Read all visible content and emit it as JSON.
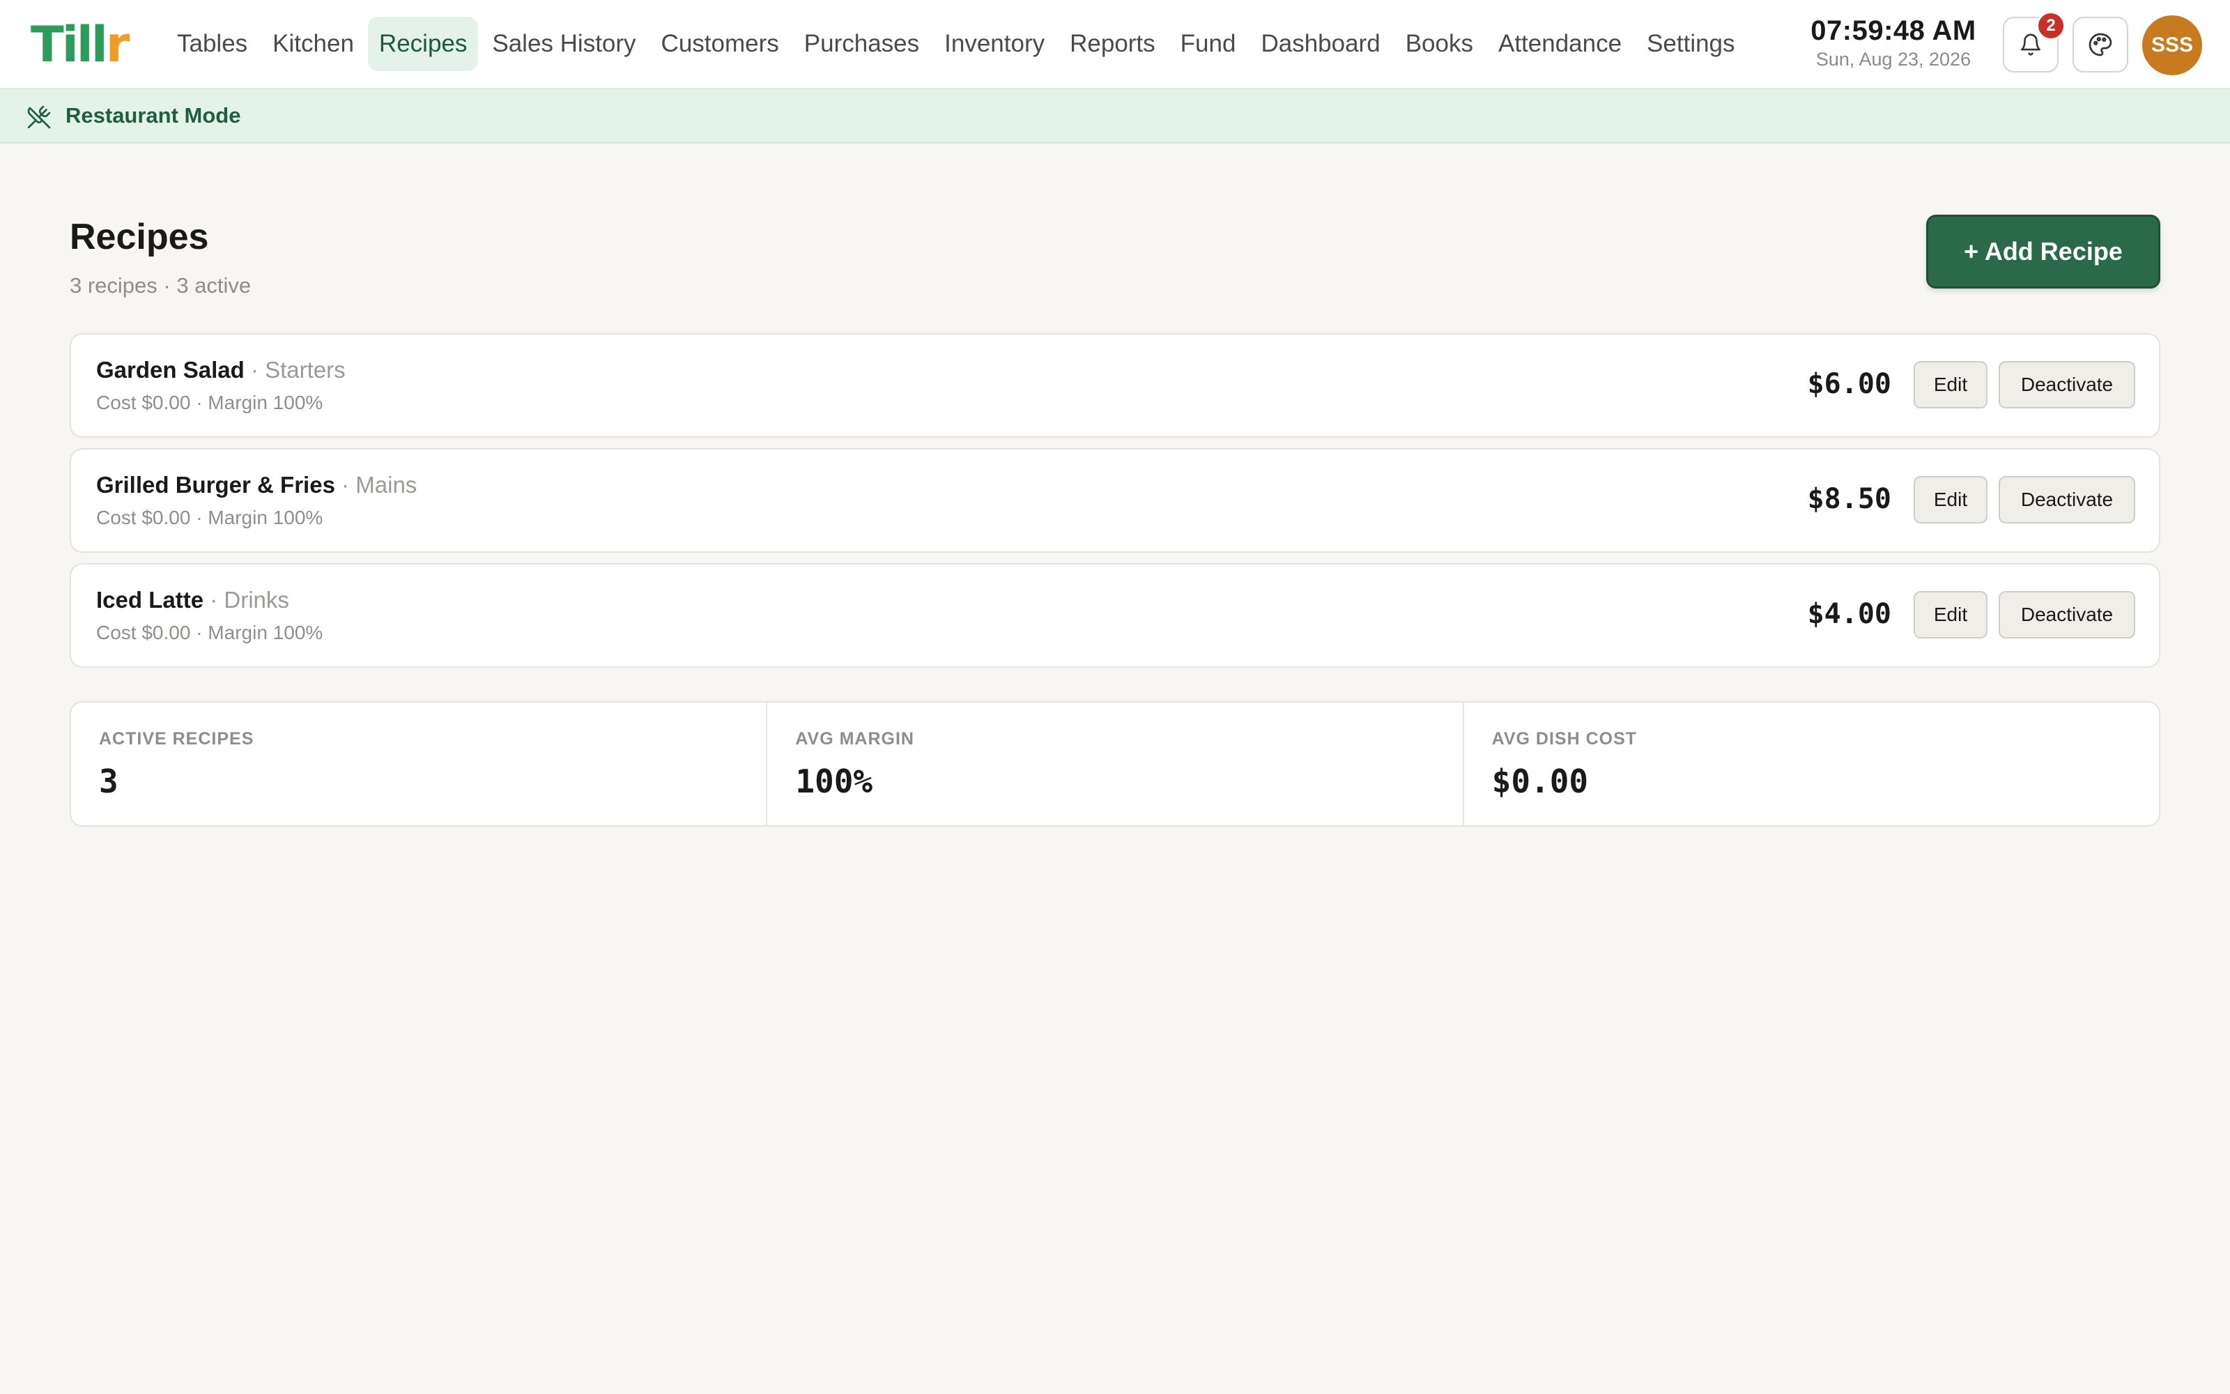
{
  "app": {
    "logo_part1": "Till",
    "logo_part2": "r",
    "brand_color": "#2c9b5c",
    "brand_accent": "#f29a23"
  },
  "nav": {
    "items": [
      {
        "label": "Tables",
        "active": false
      },
      {
        "label": "Kitchen",
        "active": false
      },
      {
        "label": "Recipes",
        "active": true
      },
      {
        "label": "Sales History",
        "active": false
      },
      {
        "label": "Customers",
        "active": false
      },
      {
        "label": "Purchases",
        "active": false
      },
      {
        "label": "Inventory",
        "active": false
      },
      {
        "label": "Reports",
        "active": false
      },
      {
        "label": "Fund",
        "active": false
      },
      {
        "label": "Dashboard",
        "active": false
      },
      {
        "label": "Books",
        "active": false
      },
      {
        "label": "Attendance",
        "active": false
      },
      {
        "label": "Settings",
        "active": false
      }
    ]
  },
  "header": {
    "time": "07:59:48 AM",
    "date": "Sun, Aug 23, 2026",
    "notification_count": "2",
    "user_initials": "SSS",
    "icons": {
      "notifications": "bell-icon",
      "theme": "palette-icon"
    }
  },
  "mode_bar": {
    "label": "Restaurant Mode",
    "icon": "utensils-crossed-icon"
  },
  "page": {
    "title": "Recipes",
    "subtitle": "3 recipes · 3 active",
    "add_button_label": "+ Add Recipe",
    "accent_color": "#2a6a4b"
  },
  "recipes": [
    {
      "name": "Garden Salad",
      "separator": " · ",
      "category": "Starters",
      "meta": "Cost $0.00 · Margin 100%",
      "price": "$6.00",
      "edit_label": "Edit",
      "deactivate_label": "Deactivate"
    },
    {
      "name": "Grilled Burger & Fries",
      "separator": " · ",
      "category": "Mains",
      "meta": "Cost $0.00 · Margin 100%",
      "price": "$8.50",
      "edit_label": "Edit",
      "deactivate_label": "Deactivate"
    },
    {
      "name": "Iced Latte",
      "separator": " · ",
      "category": "Drinks",
      "meta": "Cost $0.00 · Margin 100%",
      "price": "$4.00",
      "edit_label": "Edit",
      "deactivate_label": "Deactivate"
    }
  ],
  "stats": [
    {
      "label": "ACTIVE RECIPES",
      "value": "3"
    },
    {
      "label": "AVG MARGIN",
      "value": "100%"
    },
    {
      "label": "AVG DISH COST",
      "value": "$0.00"
    }
  ]
}
